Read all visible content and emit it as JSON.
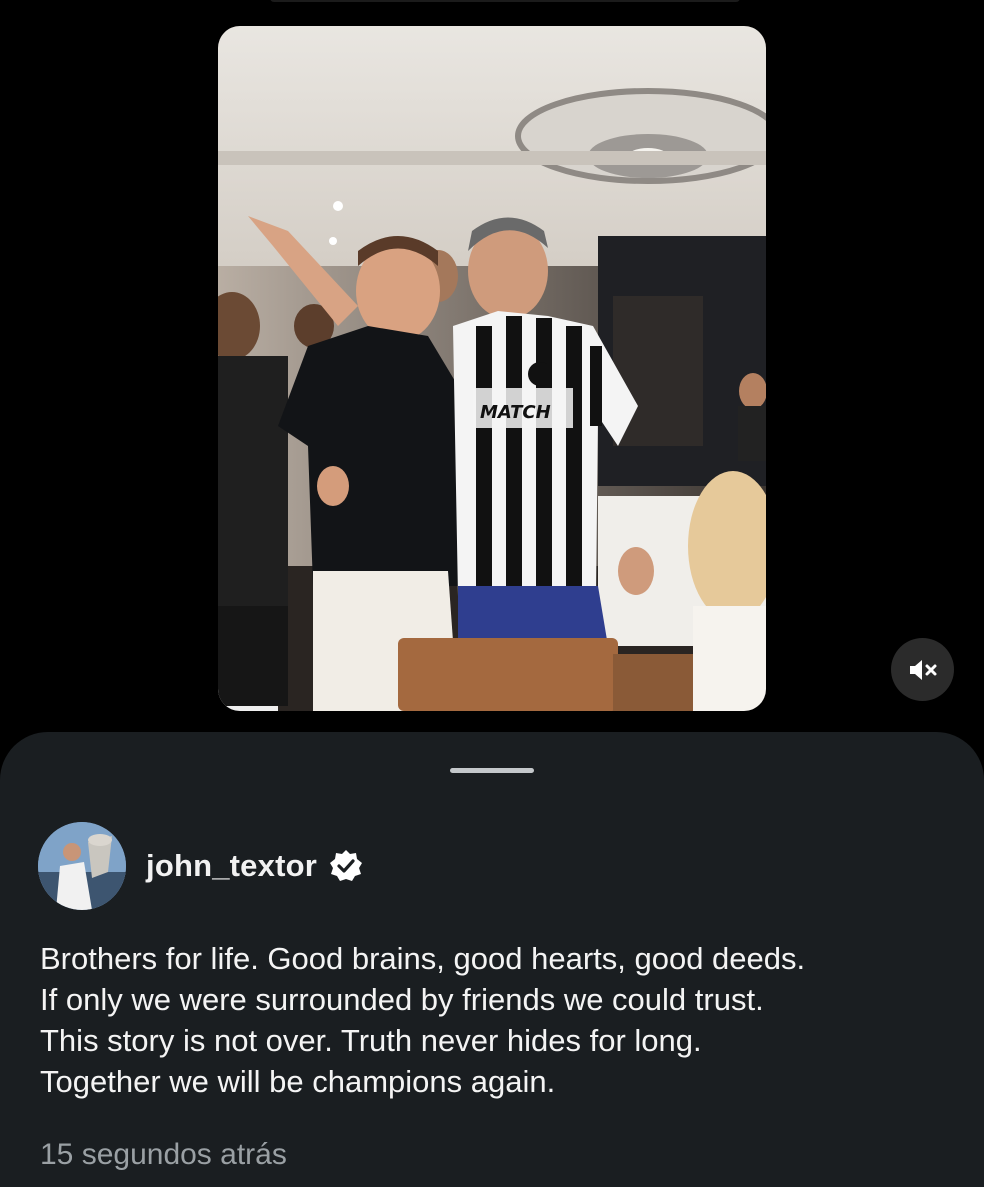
{
  "story": {
    "photo_alt": "Two men embracing in a restaurant, one wearing a black and white striped Botafogo jersey",
    "mute_icon": "speaker-muted-icon"
  },
  "post": {
    "username": "john_textor",
    "verified_icon": "verified-badge-icon",
    "caption_lines": [
      "Brothers for life. Good brains, good hearts, good deeds.",
      "If only we were surrounded by friends we could trust.",
      "This story is not over. Truth never hides for long.",
      "Together we will be champions again."
    ],
    "timestamp": "15 segundos atrás"
  },
  "colors": {
    "background": "#000000",
    "sheet": "#1a1e21",
    "text": "#f4f4f4",
    "muted_text": "#9aa0a4"
  }
}
